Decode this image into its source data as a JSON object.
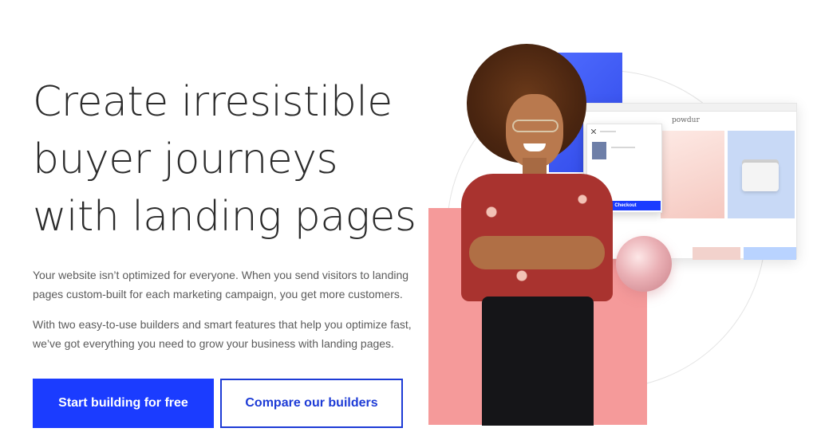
{
  "hero": {
    "headline": "Create irresistible buyer journeys with landing pages",
    "paragraph_1": "Your website isn’t optimized for everyone. When you send visitors to landing pages custom-built for each marketing campaign, you get more customers.",
    "paragraph_2": "With two easy-to-use builders and smart features that help you optimize fast, we’ve got everything you need to grow your business with landing pages.",
    "primary_cta": "Start building for free",
    "secondary_cta": "Compare our builders"
  },
  "mockup": {
    "brand": "powdur",
    "checkout_label": "Checkout"
  },
  "colors": {
    "primary": "#1b3cff",
    "secondary_border": "#1d3bd6",
    "accent_pink": "#f59a9a",
    "accent_blue": "#3d5aff"
  },
  "icons": [
    "close-icon",
    "cursor-hand-icon"
  ]
}
